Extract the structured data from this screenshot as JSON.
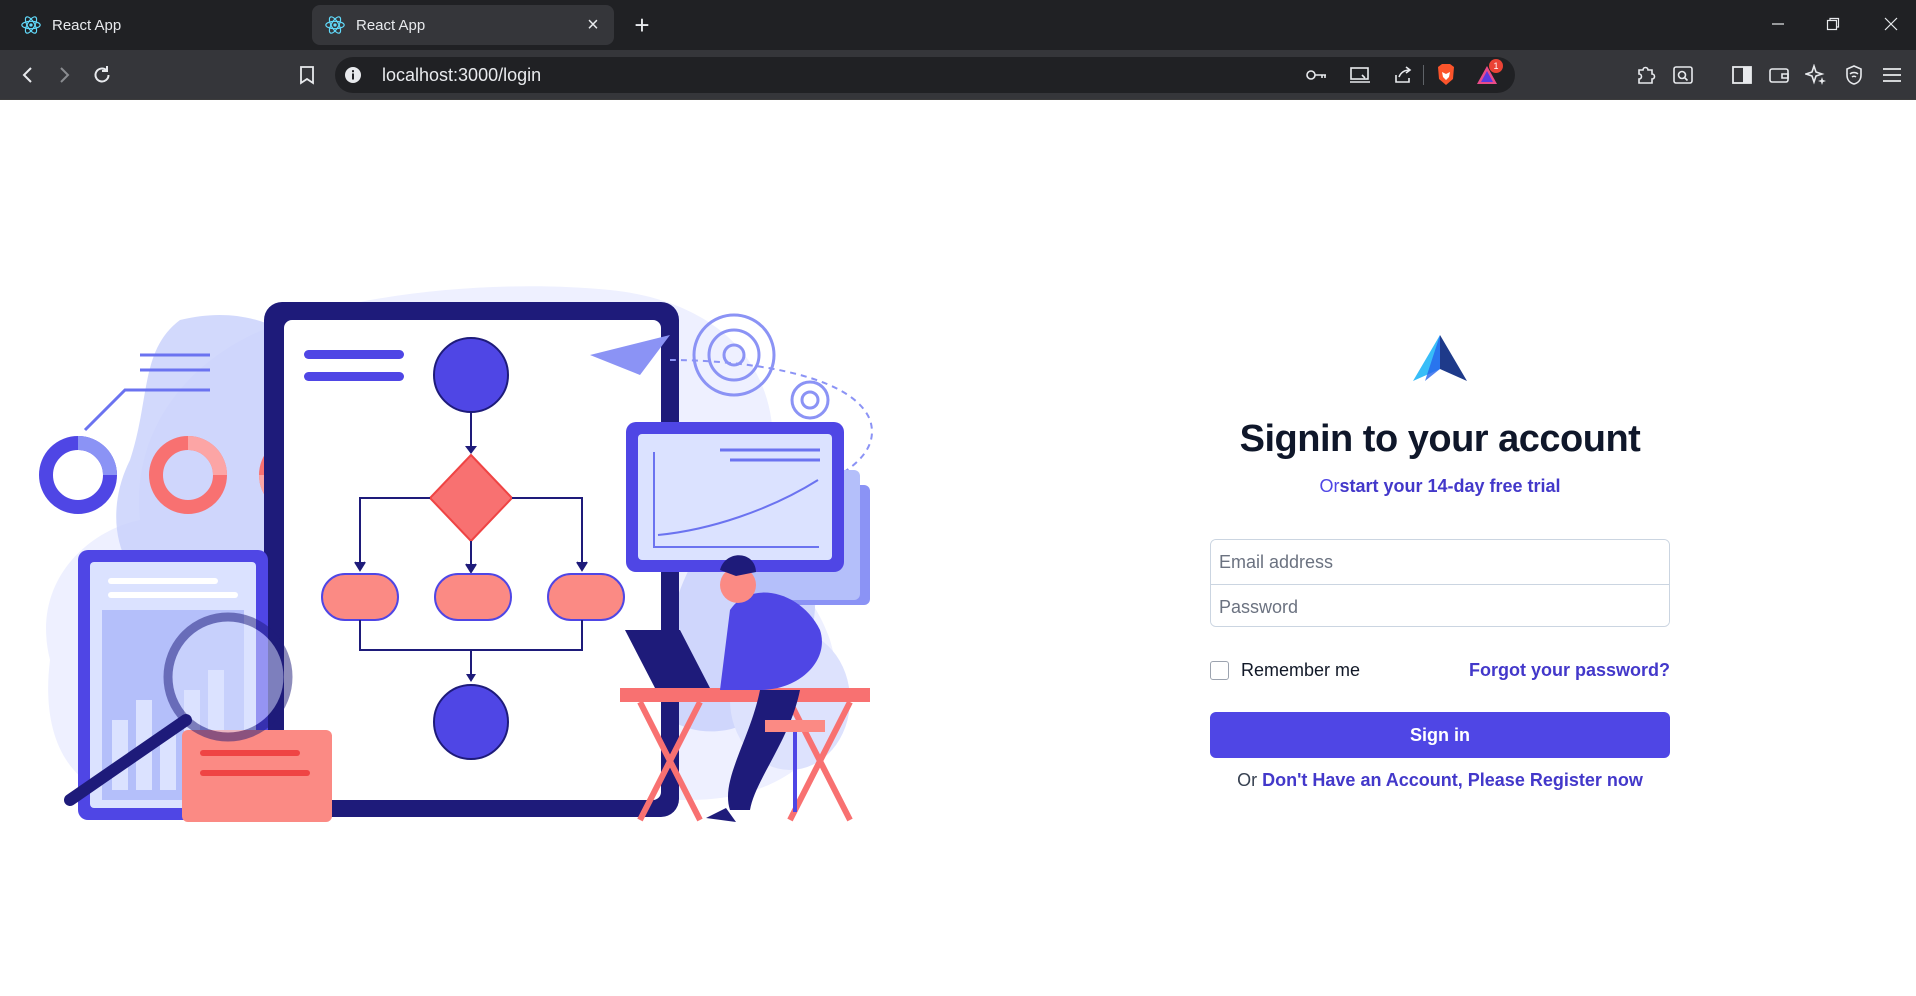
{
  "browser": {
    "tabs": [
      {
        "title": "React App",
        "active": false
      },
      {
        "title": "React App",
        "active": true
      }
    ],
    "url": "localhost:3000/login",
    "extension_badge": "1"
  },
  "login": {
    "heading": "Signin to your account",
    "subheading_prefix": "Or",
    "subheading_link": "start your 14-day free trial",
    "email_placeholder": "Email address",
    "password_placeholder": "Password",
    "remember_label": "Remember me",
    "forgot_link": "Forgot your password?",
    "signin_label": "Sign in",
    "register_prefix": "Or ",
    "register_link": "Don't Have an Account, Please Register now"
  },
  "colors": {
    "accent": "#4f46e5",
    "illustration_primary": "#4f46e5",
    "illustration_dark": "#1e1b7a",
    "illustration_coral": "#f87171",
    "illustration_light": "#dbe2ff"
  }
}
